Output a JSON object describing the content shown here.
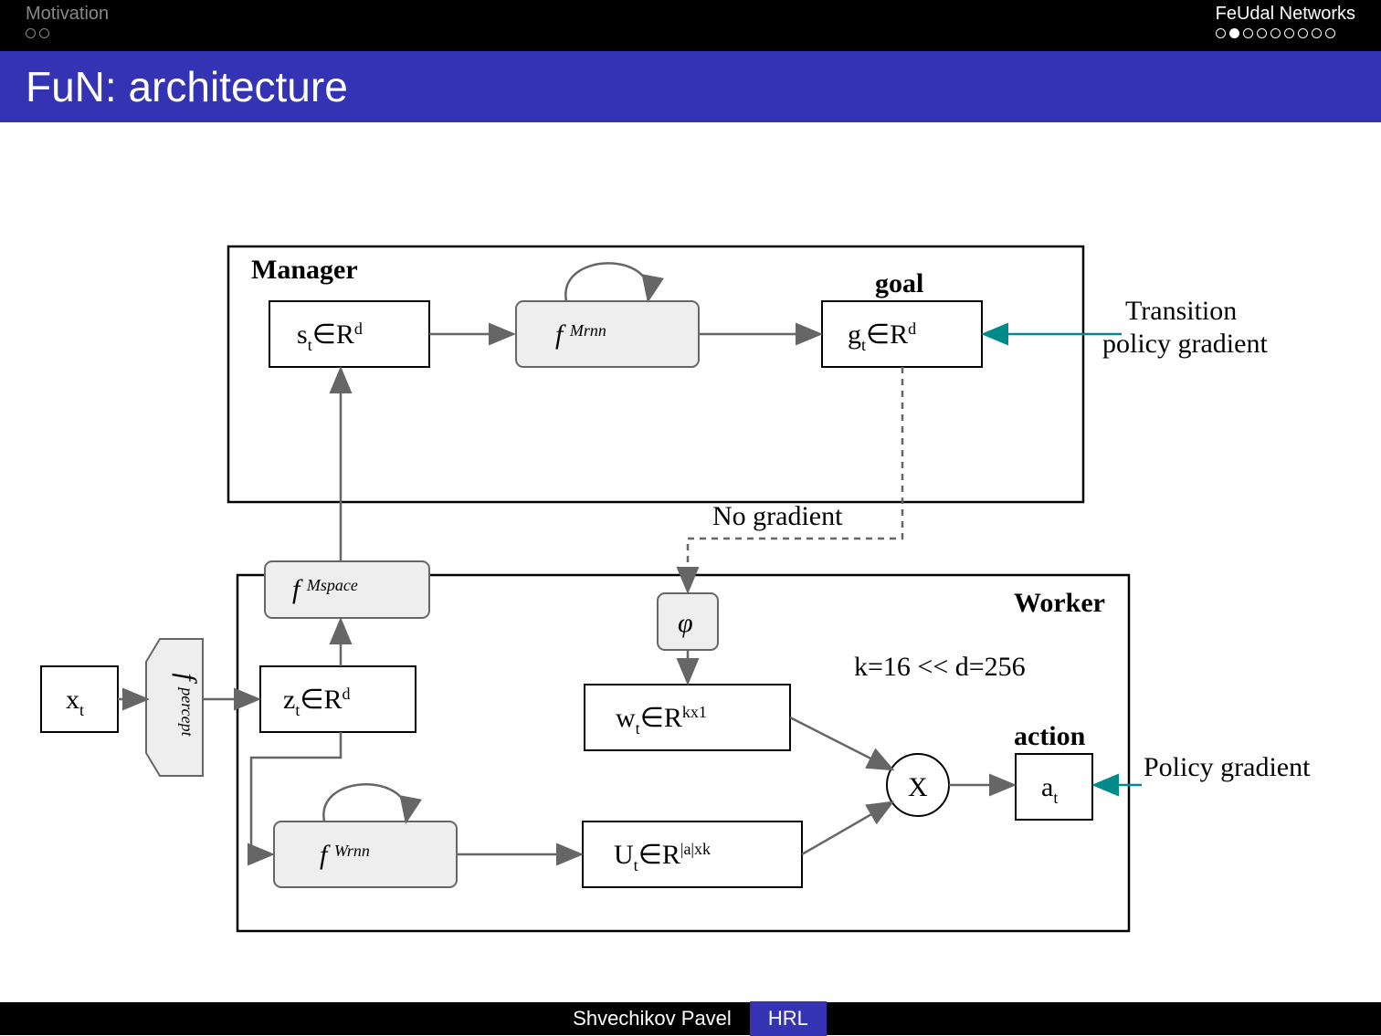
{
  "nav": {
    "left": {
      "label": "Motivation",
      "total": 2,
      "current": 0
    },
    "right": {
      "label": "FeUdal Networks",
      "total": 9,
      "current": 2
    }
  },
  "title": "FuN: architecture",
  "footer": {
    "author": "Shvechikov Pavel",
    "topic": "HRL"
  },
  "diagram": {
    "manager_label": "Manager",
    "worker_label": "Worker",
    "xt": "x",
    "xt_sub": "t",
    "f_percept": "f",
    "f_percept_sup": "percept",
    "zt": "z",
    "zt_sub": "t",
    "zt_rest": "∈R",
    "zt_sup": "d",
    "f_mspace": "f",
    "f_mspace_sup": "Mspace",
    "st": "s",
    "st_sub": "t",
    "st_rest": "∈R",
    "st_sup": "d",
    "f_mrnn": "f",
    "f_mrnn_sup": "Mrnn",
    "goal_label": "goal",
    "gt": "g",
    "gt_sub": "t",
    "gt_rest": "∈R",
    "gt_sup": "d",
    "transition": "Transition",
    "policy_gradient": "policy gradient",
    "no_gradient": "No gradient",
    "phi": "φ",
    "wt": "w",
    "wt_sub": "t",
    "wt_rest": "∈R",
    "wt_sup": "kx1",
    "k_note": "k=16 << d=256",
    "f_wrnn": "f",
    "f_wrnn_sup": "Wrnn",
    "Ut": "U",
    "Ut_sub": "t",
    "Ut_rest": "∈R",
    "Ut_sup": "|a|xk",
    "mult": "X",
    "action_label": "action",
    "at": "a",
    "at_sub": "t",
    "pg": "Policy gradient"
  }
}
